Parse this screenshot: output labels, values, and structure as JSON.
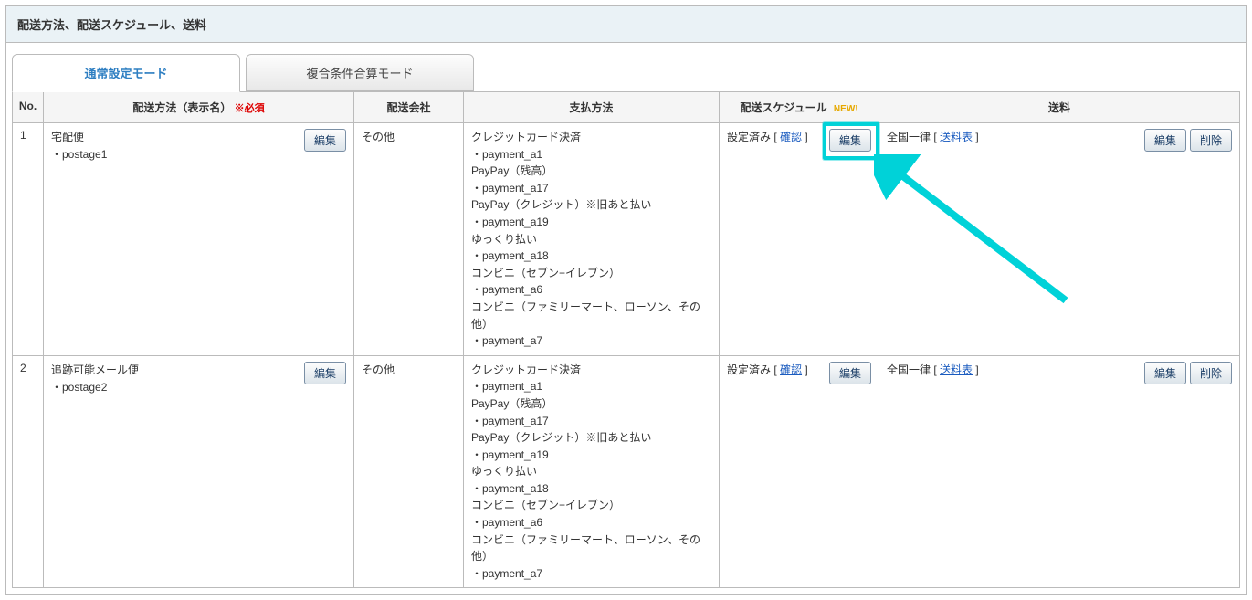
{
  "header": {
    "title": "配送方法、配送スケジュール、送料"
  },
  "tabs": {
    "active": "通常設定モード",
    "inactive": "複合条件合算モード"
  },
  "columns": {
    "no": "No.",
    "method": "配送方法（表示名）",
    "required": "※必須",
    "carrier": "配送会社",
    "payment": "支払方法",
    "schedule": "配送スケジュール",
    "new": "NEW!",
    "fee": "送料"
  },
  "buttons": {
    "edit": "編集",
    "delete": "削除",
    "confirm": "確認"
  },
  "status": {
    "configured": "設定済み",
    "flat": "全国一律",
    "feeTable": "送料表"
  },
  "payments": [
    "クレジットカード決済",
    "・payment_a1",
    "PayPay（残高）",
    "・payment_a17",
    "PayPay（クレジット）※旧あと払い",
    "・payment_a19",
    "ゆっくり払い",
    "・payment_a18",
    "コンビニ（セブン−イレブン）",
    "・payment_a6",
    "コンビニ（ファミリーマート、ローソン、その他）",
    "・payment_a7"
  ],
  "rows": [
    {
      "no": "1",
      "method_name": "宅配便",
      "method_code": "・postage1",
      "carrier": "その他"
    },
    {
      "no": "2",
      "method_name": "追跡可能メール便",
      "method_code": "・postage2",
      "carrier": "その他"
    }
  ]
}
